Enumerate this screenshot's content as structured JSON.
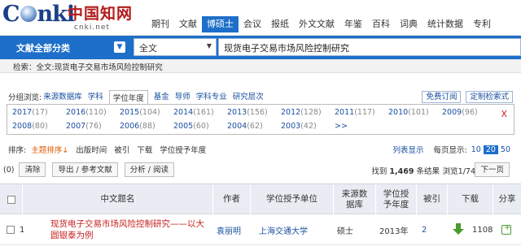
{
  "logo": {
    "brand": "CNKI",
    "cn": "中国知网",
    "url": "cnki.net"
  },
  "nav": [
    "期刊",
    "文献",
    "博硕士",
    "会议",
    "报纸",
    "外文文献",
    "年鉴",
    "百科",
    "词典",
    "统计数据",
    "专利"
  ],
  "nav_active": 2,
  "search": {
    "category": "文献全部分类",
    "field": "全文",
    "query": "现货电子交易市场风险控制研究"
  },
  "breadcrumb": "检索：全文:现货电子交易市场风险控制研究",
  "group": {
    "label": "分组浏览:",
    "items": [
      "来源数据库",
      "学科",
      "学位年度",
      "基金",
      "导师",
      "学科专业",
      "研究层次"
    ],
    "active": 2,
    "buttons": [
      "免费订阅",
      "定制检索式"
    ]
  },
  "years": [
    [
      [
        "2017",
        "(17)"
      ],
      [
        "2016",
        "(110)"
      ],
      [
        "2015",
        "(104)"
      ],
      [
        "2014",
        "(161)"
      ],
      [
        "2013",
        "(156)"
      ],
      [
        "2012",
        "(128)"
      ],
      [
        "2011",
        "(117)"
      ],
      [
        "2010",
        "(101)"
      ],
      [
        "2009",
        "(96)"
      ]
    ],
    [
      [
        "2008",
        "(80)"
      ],
      [
        "2007",
        "(76)"
      ],
      [
        "2006",
        "(88)"
      ],
      [
        "2005",
        "(60)"
      ],
      [
        "2004",
        "(62)"
      ],
      [
        "2003",
        "(42)"
      ],
      [
        ">>",
        ""
      ]
    ]
  ],
  "year_close": "X",
  "sort": {
    "label": "排序:",
    "items": [
      "主题排序",
      "出版时间",
      "被引",
      "下载",
      "学位授予年度"
    ],
    "active": 0,
    "list_view": "列表显示",
    "per_page_label": "每页显示:",
    "per_page": [
      "10",
      "20",
      "50"
    ],
    "per_page_active": 1
  },
  "actions": {
    "selected": "(0)",
    "clear": "清除",
    "export": "导出 / 参考文献",
    "analyze": "分析 / 阅读",
    "found_pre": "找到 ",
    "found_count": "1,469",
    "found_post": " 条结果",
    "page": "浏览1/74",
    "next": "下一页"
  },
  "table": {
    "headers": [
      "中文题名",
      "作者",
      "学位授予单位",
      "来源数据库",
      "学位授予年度",
      "被引",
      "下载",
      "分享"
    ],
    "rows": [
      {
        "num": "1",
        "title": "现货电子交易市场风险控制研究——以大圆银泰为例",
        "author": "袁丽明",
        "unit": "上海交通大学",
        "db": "硕士",
        "year": "2013年",
        "cited": "2",
        "downloads": "1108"
      }
    ]
  }
}
